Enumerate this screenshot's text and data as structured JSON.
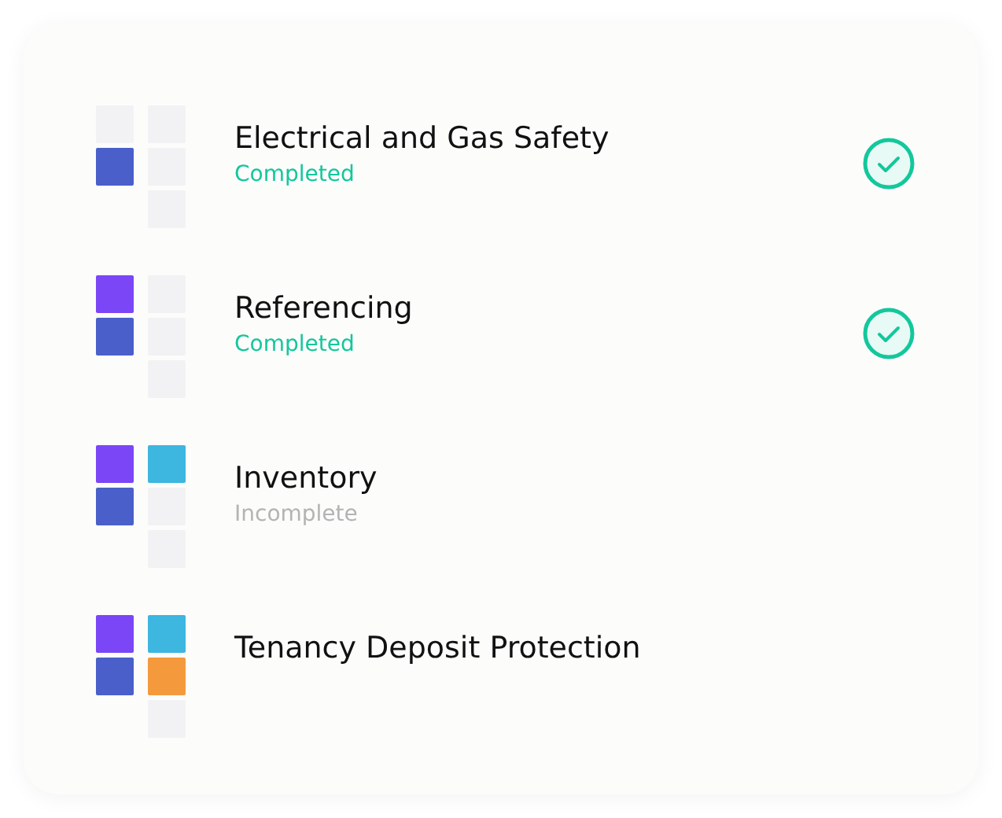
{
  "steps": [
    {
      "title": "Electrical and Gas Safety",
      "status": "Completed",
      "checked": true,
      "tiles": [
        {
          "color": "#f2f2f4"
        },
        {
          "color": "#4a5fc9"
        },
        {
          "color": "#f2f2f4"
        },
        {
          "color": "#f2f2f4"
        },
        {
          "color": "#f2f2f4"
        }
      ]
    },
    {
      "title": "Referencing",
      "status": "Completed",
      "checked": true,
      "tiles": [
        {
          "color": "#7b46f6"
        },
        {
          "color": "#4a5fc9"
        },
        {
          "color": "#f2f2f4"
        },
        {
          "color": "#f2f2f4"
        },
        {
          "color": "#f2f2f4"
        }
      ]
    },
    {
      "title": "Inventory",
      "status": "Incomplete",
      "checked": false,
      "tiles": [
        {
          "color": "#7b46f6"
        },
        {
          "color": "#4a5fc9"
        },
        {
          "color": "#3db6e0"
        },
        {
          "color": "#f2f2f4"
        },
        {
          "color": "#f2f2f4"
        }
      ]
    },
    {
      "title": "Tenancy Deposit Protection",
      "checked": false,
      "tiles": [
        {
          "color": "#7b46f6"
        },
        {
          "color": "#4a5fc9"
        },
        {
          "color": "#3db6e0"
        },
        {
          "color": "#f59a3c"
        },
        {
          "color": "#f2f2f4"
        }
      ]
    }
  ]
}
